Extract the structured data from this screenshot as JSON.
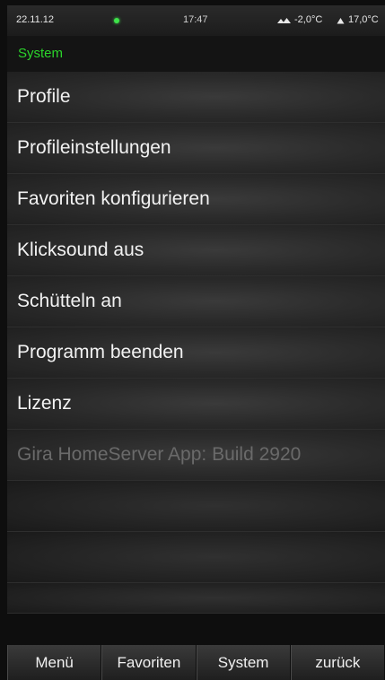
{
  "status_bar": {
    "date": "22.11.12",
    "time": "17:47",
    "outdoor_temp": "-2,0°C",
    "indoor_temp": "17,0°C",
    "indicator_color": "#3ee34a",
    "outdoor_icon": "outdoor-temperature-icon",
    "indoor_icon": "indoor-temperature-icon"
  },
  "header": {
    "title": "System",
    "title_color": "#2bd42b"
  },
  "menu": {
    "items": [
      {
        "label": "Profile"
      },
      {
        "label": "Profileinstellungen"
      },
      {
        "label": "Favoriten konfigurieren"
      },
      {
        "label": "Klicksound aus"
      },
      {
        "label": "Schütteln an"
      },
      {
        "label": "Programm beenden"
      },
      {
        "label": "Lizenz"
      },
      {
        "label": "Gira HomeServer App: Build 2920"
      }
    ]
  },
  "bottom_nav": {
    "menu": "Menü",
    "favorites": "Favoriten",
    "system": "System",
    "back": "zurück"
  }
}
